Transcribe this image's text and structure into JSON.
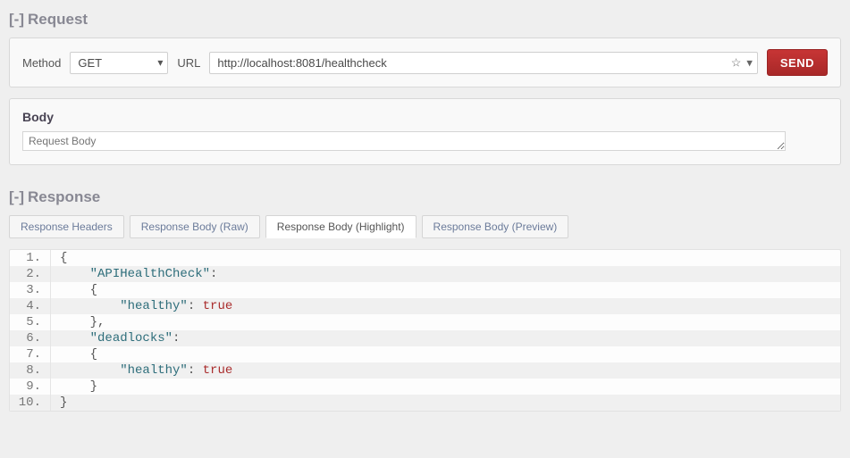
{
  "request": {
    "section_prefix": "[-]",
    "section_title": "Request",
    "method_label": "Method",
    "method_value": "GET",
    "url_label": "URL",
    "url_value": "http://localhost:8081/healthcheck",
    "send_label": "SEND",
    "body_header": "Body",
    "body_placeholder": "Request Body"
  },
  "response": {
    "section_prefix": "[-]",
    "section_title": "Response",
    "tabs": [
      {
        "label": "Response Headers",
        "active": false
      },
      {
        "label": "Response Body (Raw)",
        "active": false
      },
      {
        "label": "Response Body (Highlight)",
        "active": true
      },
      {
        "label": "Response Body (Preview)",
        "active": false
      }
    ],
    "code_lines": [
      {
        "n": "1.",
        "tokens": [
          {
            "t": "{",
            "c": ""
          }
        ]
      },
      {
        "n": "2.",
        "tokens": [
          {
            "t": "    ",
            "c": ""
          },
          {
            "t": "\"APIHealthCheck\"",
            "c": "key"
          },
          {
            "t": ":",
            "c": ""
          }
        ]
      },
      {
        "n": "3.",
        "tokens": [
          {
            "t": "    {",
            "c": ""
          }
        ]
      },
      {
        "n": "4.",
        "tokens": [
          {
            "t": "        ",
            "c": ""
          },
          {
            "t": "\"healthy\"",
            "c": "key"
          },
          {
            "t": ": ",
            "c": ""
          },
          {
            "t": "true",
            "c": "bool"
          }
        ]
      },
      {
        "n": "5.",
        "tokens": [
          {
            "t": "    },",
            "c": ""
          }
        ]
      },
      {
        "n": "6.",
        "tokens": [
          {
            "t": "    ",
            "c": ""
          },
          {
            "t": "\"deadlocks\"",
            "c": "key"
          },
          {
            "t": ":",
            "c": ""
          }
        ]
      },
      {
        "n": "7.",
        "tokens": [
          {
            "t": "    {",
            "c": ""
          }
        ]
      },
      {
        "n": "8.",
        "tokens": [
          {
            "t": "        ",
            "c": ""
          },
          {
            "t": "\"healthy\"",
            "c": "key"
          },
          {
            "t": ": ",
            "c": ""
          },
          {
            "t": "true",
            "c": "bool"
          }
        ]
      },
      {
        "n": "9.",
        "tokens": [
          {
            "t": "    }",
            "c": ""
          }
        ]
      },
      {
        "n": "10.",
        "tokens": [
          {
            "t": "}",
            "c": ""
          }
        ]
      }
    ]
  }
}
